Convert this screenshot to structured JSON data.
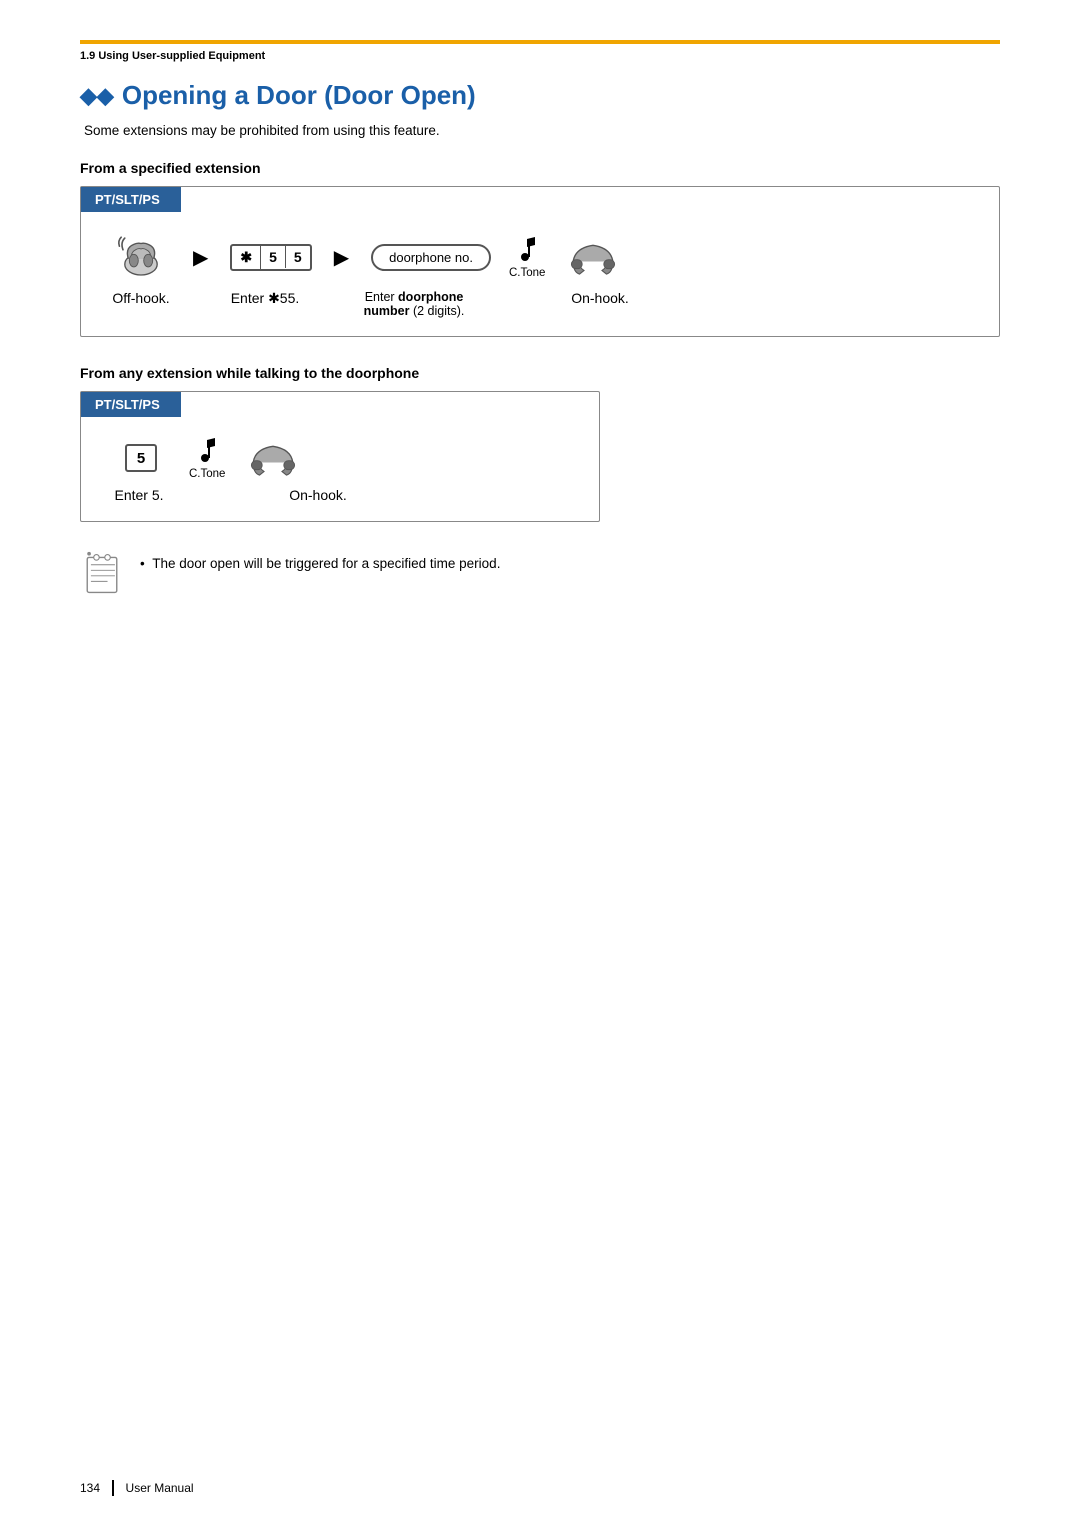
{
  "page": {
    "section_label": "1.9 Using User-supplied Equipment",
    "title_diamonds": "◆◆",
    "title": "Opening a Door (Door Open)",
    "intro": "Some extensions may be prohibited from using this feature.",
    "section1": {
      "heading": "From a specified extension",
      "box_label": "PT/SLT/PS",
      "steps": [
        {
          "id": "offhook",
          "label": "Off-hook."
        },
        {
          "id": "enter_star55",
          "label": "Enter ✱55."
        },
        {
          "id": "doorphone",
          "label": "Enter doorphone\nnumber (2 digits)."
        },
        {
          "id": "ctone",
          "label": "C.Tone"
        },
        {
          "id": "onhook",
          "label": "On-hook."
        }
      ],
      "enter_star55_text": "Enter ✱55.",
      "doorphone_key_text": "doorphone no.",
      "ctone_text": "C.Tone"
    },
    "section2": {
      "heading": "From any extension while talking to the doorphone",
      "box_label": "PT/SLT/PS",
      "steps": [
        {
          "id": "enter5",
          "label": "Enter 5."
        },
        {
          "id": "ctone2",
          "label": "C.Tone"
        },
        {
          "id": "onhook2",
          "label": "On-hook."
        }
      ],
      "enter5_key": "5",
      "ctone_text": "C.Tone"
    },
    "note": {
      "bullet": "•",
      "text": "The door open will be triggered for a specified time period."
    },
    "footer": {
      "page_number": "134",
      "label": "User Manual"
    }
  }
}
